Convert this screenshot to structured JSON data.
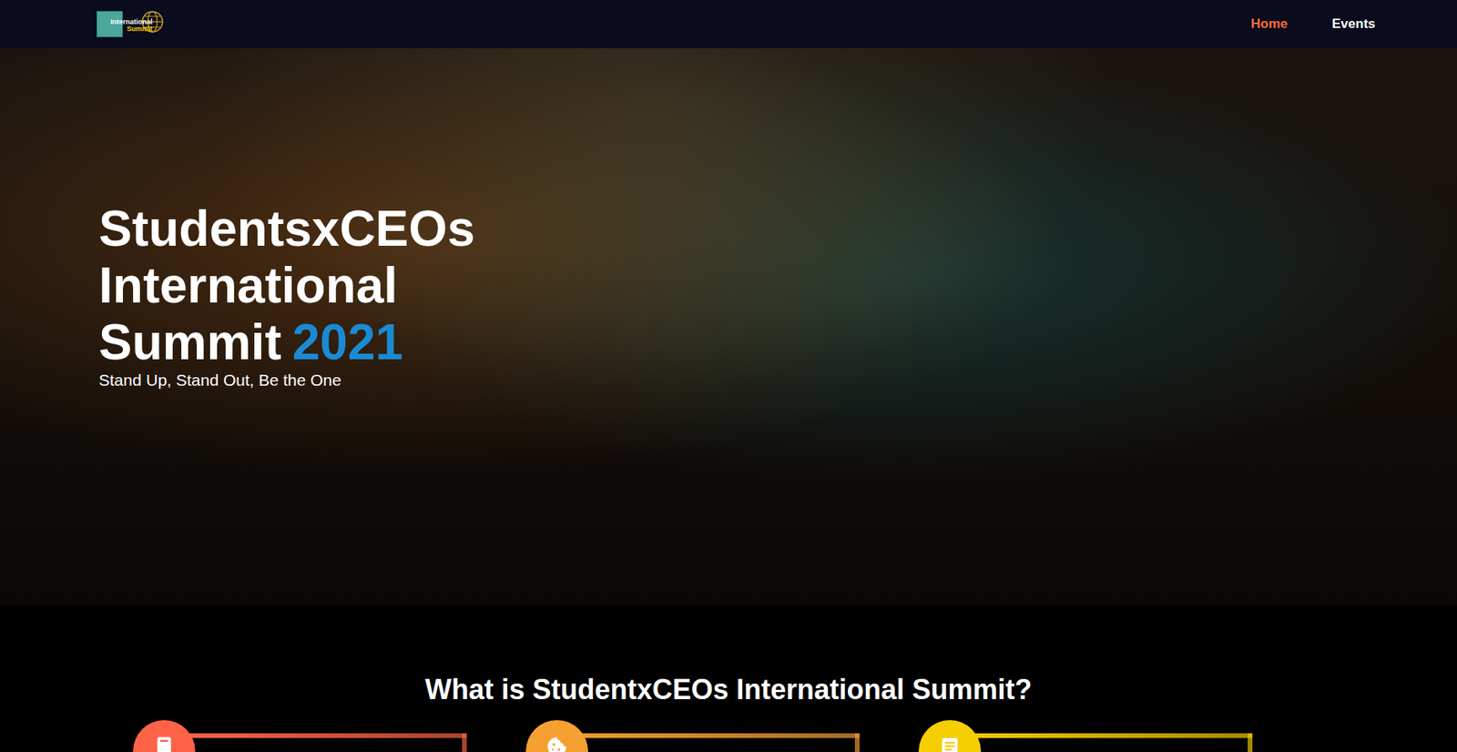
{
  "nav": {
    "logo": {
      "line1": "International",
      "line2": "Summit"
    },
    "links": [
      {
        "label": "Home",
        "selected": true
      },
      {
        "label": "Events",
        "selected": false
      }
    ]
  },
  "hero": {
    "title_lines": [
      "StudentsxCEOs",
      "International",
      "Summit"
    ],
    "year": "2021",
    "subtitle": "Stand Up, Stand Out, Be the One"
  },
  "about": {
    "heading": "What is StudentxCEOs International Summit?",
    "cards": [
      {
        "color": "#ff6347"
      },
      {
        "color": "#f5a030"
      },
      {
        "color": "#f5cf00"
      }
    ]
  }
}
